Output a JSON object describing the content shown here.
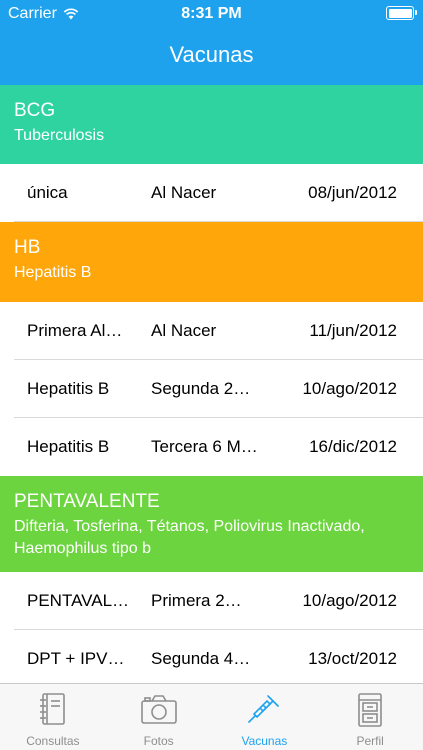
{
  "status_bar": {
    "carrier": "Carrier",
    "time": "8:31 PM",
    "wifi_icon": "wifi-icon",
    "battery_icon": "battery-icon"
  },
  "nav": {
    "title": "Vacunas"
  },
  "groups": [
    {
      "name": "BCG",
      "description": "Tuberculosis",
      "color": "#2fd3a0",
      "rows": [
        {
          "dose": "única",
          "when": "Al Nacer",
          "date": "08/jun/2012"
        }
      ]
    },
    {
      "name": "HB",
      "description": "Hepatitis B",
      "color": "#ffa60a",
      "rows": [
        {
          "dose": "Primera Al…",
          "when": "Al Nacer",
          "date": "11/jun/2012"
        },
        {
          "dose": "Hepatitis B",
          "when": "Segunda 2…",
          "date": "10/ago/2012"
        },
        {
          "dose": "Hepatitis B",
          "when": "Tercera 6 M…",
          "date": "16/dic/2012"
        }
      ]
    },
    {
      "name": "PENTAVALENTE",
      "description": "Difteria, Tosferina, Tétanos, Poliovirus Inactivado, Haemophilus tipo b",
      "color": "#6bd43e",
      "rows": [
        {
          "dose": "PENTAVAL…",
          "when": "Primera 2…",
          "date": "10/ago/2012"
        },
        {
          "dose": "DPT + IPV…",
          "when": "Segunda 4…",
          "date": "13/oct/2012"
        }
      ]
    }
  ],
  "tabs": [
    {
      "label": "Consultas",
      "icon": "notebook-icon",
      "active": false
    },
    {
      "label": "Fotos",
      "icon": "camera-icon",
      "active": false
    },
    {
      "label": "Vacunas",
      "icon": "syringe-icon",
      "active": true
    },
    {
      "label": "Perfil",
      "icon": "cabinet-icon",
      "active": false
    }
  ],
  "colors": {
    "accent": "#1ea2ee",
    "tab_inactive": "#8e8e8e"
  }
}
